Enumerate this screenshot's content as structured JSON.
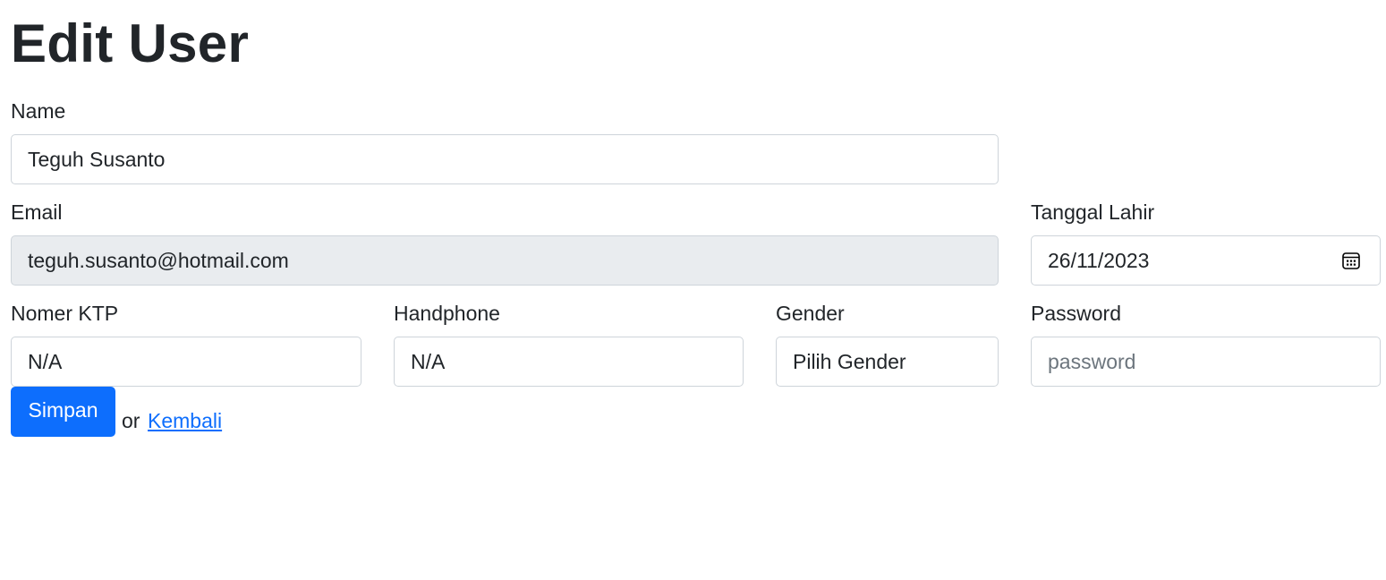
{
  "page": {
    "title": "Edit User"
  },
  "form": {
    "name": {
      "label": "Name",
      "value": "Teguh Susanto"
    },
    "email": {
      "label": "Email",
      "value": "teguh.susanto@hotmail.com",
      "disabled": true
    },
    "birth_date": {
      "label": "Tanggal Lahir",
      "value": "26/11/2023",
      "icon": "calendar-icon"
    },
    "ktp": {
      "label": "Nomer KTP",
      "value": "N/A"
    },
    "phone": {
      "label": "Handphone",
      "value": "N/A"
    },
    "gender": {
      "label": "Gender",
      "selected": "Pilih Gender"
    },
    "password": {
      "label": "Password",
      "value": "",
      "placeholder": "password"
    }
  },
  "actions": {
    "save_label": "Simpan",
    "or_text": "or",
    "back_label": "Kembali"
  },
  "colors": {
    "primary": "#0d6efd",
    "disabled_bg": "#e9ecef",
    "border": "#ced4da",
    "text": "#212529",
    "placeholder": "#6c757d"
  }
}
